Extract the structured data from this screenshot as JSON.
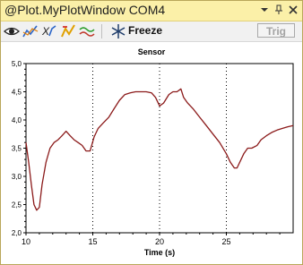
{
  "window": {
    "title": "@Plot.MyPlotWindow COM4",
    "title_bar_color": "#fbf0a8",
    "controls": [
      "chevron-down-icon",
      "pin-icon",
      "close-icon"
    ]
  },
  "toolbar": {
    "tools": [
      "eye-icon",
      "line-plot-icon",
      "xy-plot-icon",
      "trigger-plot-icon",
      "wave-plot-icon"
    ],
    "freeze_label": "Freeze",
    "freeze_icon": "snowflake-icon",
    "trig_label": "Trig"
  },
  "chart_data": {
    "type": "line",
    "title": "Sensor",
    "xlabel": "Time (s)",
    "ylabel": "",
    "xlim": [
      10,
      30
    ],
    "ylim": [
      2.0,
      5.0
    ],
    "x_ticks": [
      "10",
      "15",
      "20",
      "25"
    ],
    "y_ticks": [
      "2,0",
      "2,5",
      "3,0",
      "3,5",
      "4,0",
      "4,5",
      "5,0"
    ],
    "grid": "vertical-dotted",
    "line_color": "#8b1a1a",
    "series": [
      {
        "x": [
          10.0,
          10.2,
          10.4,
          10.6,
          10.8,
          11.0,
          11.2,
          11.5,
          11.8,
          12.1,
          12.4,
          12.7,
          13.0,
          13.3,
          13.6,
          13.9,
          14.2,
          14.5,
          14.8,
          15.1,
          15.4,
          15.8,
          16.2,
          16.6,
          17.0,
          17.4,
          17.8,
          18.2,
          18.6,
          19.0,
          19.4,
          19.7,
          20.0,
          20.3,
          20.7,
          21.0,
          21.3,
          21.6,
          21.8,
          22.1,
          22.5,
          23.0,
          23.5,
          24.0,
          24.5,
          25.0,
          25.3,
          25.6,
          25.8,
          26.3,
          26.6,
          26.9,
          27.3,
          27.6,
          28.0,
          28.4,
          28.8,
          29.2,
          29.6,
          30.0
        ],
        "y": [
          3.6,
          3.25,
          2.85,
          2.5,
          2.4,
          2.45,
          2.85,
          3.25,
          3.5,
          3.6,
          3.65,
          3.72,
          3.8,
          3.72,
          3.65,
          3.6,
          3.55,
          3.45,
          3.45,
          3.7,
          3.85,
          3.95,
          4.05,
          4.2,
          4.35,
          4.45,
          4.48,
          4.5,
          4.5,
          4.5,
          4.48,
          4.4,
          4.25,
          4.3,
          4.45,
          4.5,
          4.5,
          4.55,
          4.4,
          4.3,
          4.2,
          4.05,
          3.9,
          3.75,
          3.6,
          3.4,
          3.25,
          3.15,
          3.15,
          3.4,
          3.5,
          3.5,
          3.55,
          3.65,
          3.72,
          3.78,
          3.82,
          3.85,
          3.88,
          3.9
        ]
      }
    ]
  }
}
